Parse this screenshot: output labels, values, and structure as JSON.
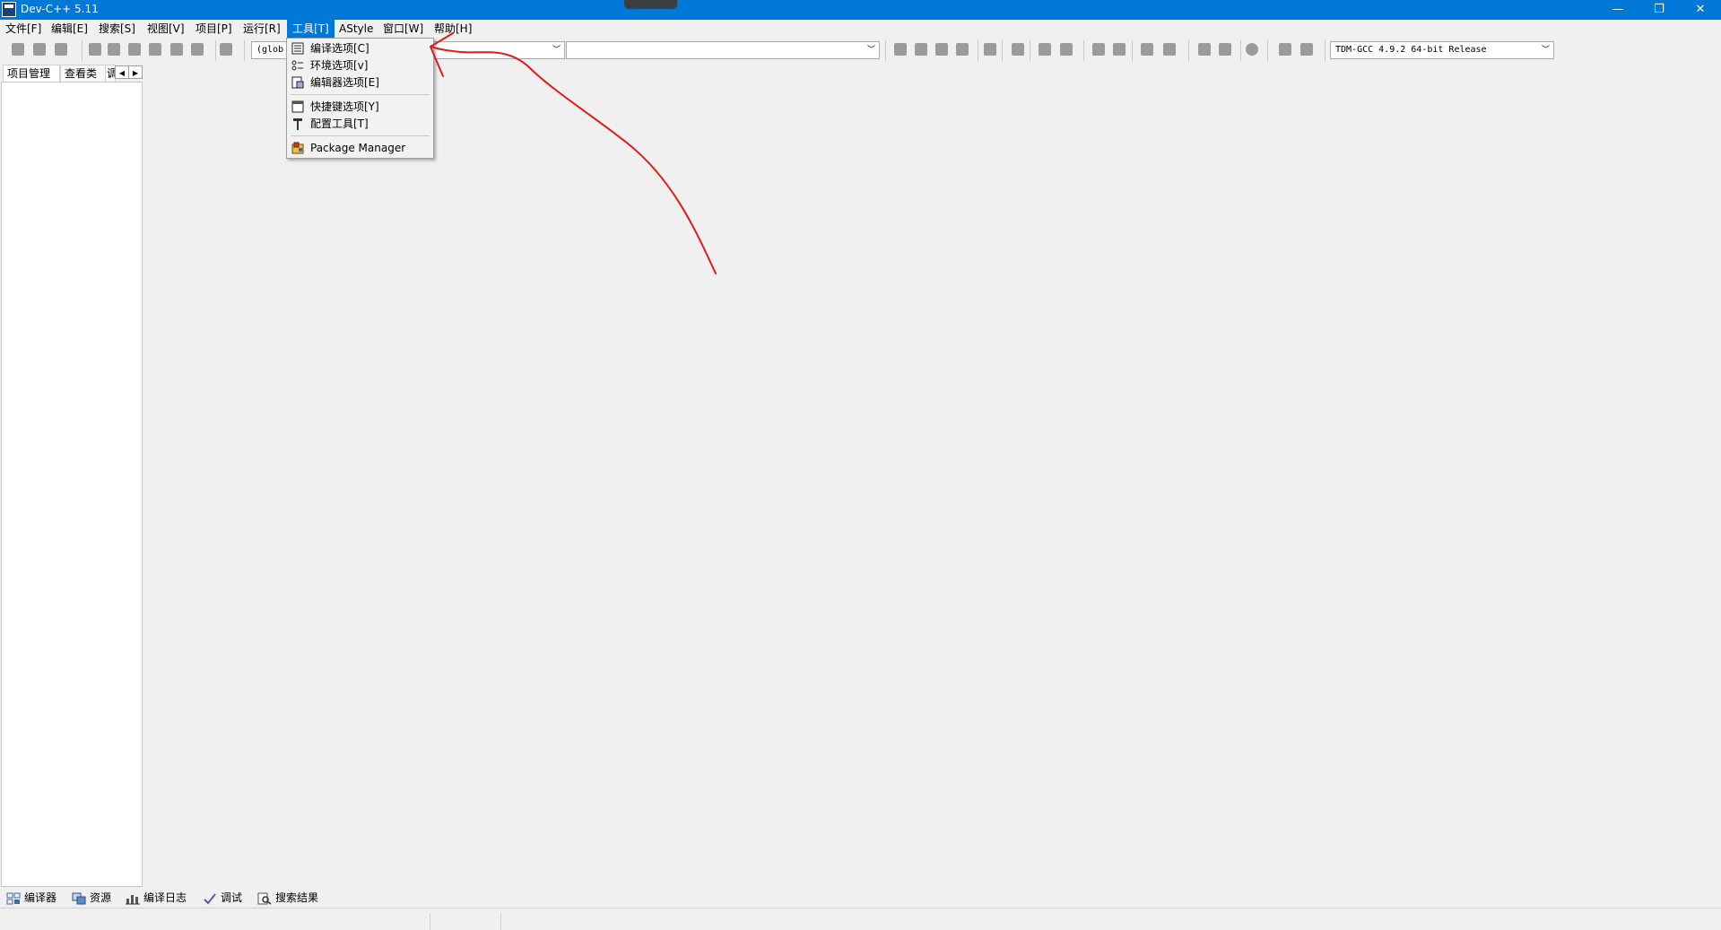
{
  "window": {
    "title": "Dev-C++ 5.11",
    "controls": {
      "minimize": "—",
      "restore": "❐",
      "close": "✕"
    }
  },
  "menubar": {
    "items": [
      {
        "label": "文件[F]"
      },
      {
        "label": "编辑[E]"
      },
      {
        "label": "搜索[S]"
      },
      {
        "label": "视图[V]"
      },
      {
        "label": "项目[P]"
      },
      {
        "label": "运行[R]"
      },
      {
        "label": "工具[T]",
        "active": true
      },
      {
        "label": "AStyle"
      },
      {
        "label": "窗口[W]"
      },
      {
        "label": "帮助[H]"
      }
    ]
  },
  "toolbar": {
    "scope_combo_value": "(glob",
    "compiler_combo_value": "TDM-GCC 4.9.2 64-bit Release"
  },
  "left_panel": {
    "tabs": [
      "项目管理",
      "查看类",
      "调"
    ]
  },
  "tools_menu": {
    "items": [
      {
        "label": "编译选项[C]",
        "icon": "compiler-options-icon"
      },
      {
        "label": "环境选项[v]",
        "icon": "environment-options-icon"
      },
      {
        "label": "编辑器选项[E]",
        "icon": "editor-options-icon"
      },
      {
        "label": "快捷键选项[Y]",
        "icon": "shortcut-options-icon"
      },
      {
        "label": "配置工具[T]",
        "icon": "configure-tools-icon"
      },
      {
        "label": "Package Manager",
        "icon": "package-manager-icon"
      }
    ]
  },
  "bottom_tabs": [
    {
      "label": "编译器",
      "icon": "compiler-grid-icon"
    },
    {
      "label": "资源",
      "icon": "resources-icon"
    },
    {
      "label": "编译日志",
      "icon": "compile-log-chart-icon"
    },
    {
      "label": "调试",
      "icon": "debug-check-icon"
    },
    {
      "label": "搜索结果",
      "icon": "search-results-icon"
    }
  ],
  "colors": {
    "titlebar": "#0078d7",
    "menu_highlight": "#0078d7",
    "annotation": "#e31b1b"
  }
}
